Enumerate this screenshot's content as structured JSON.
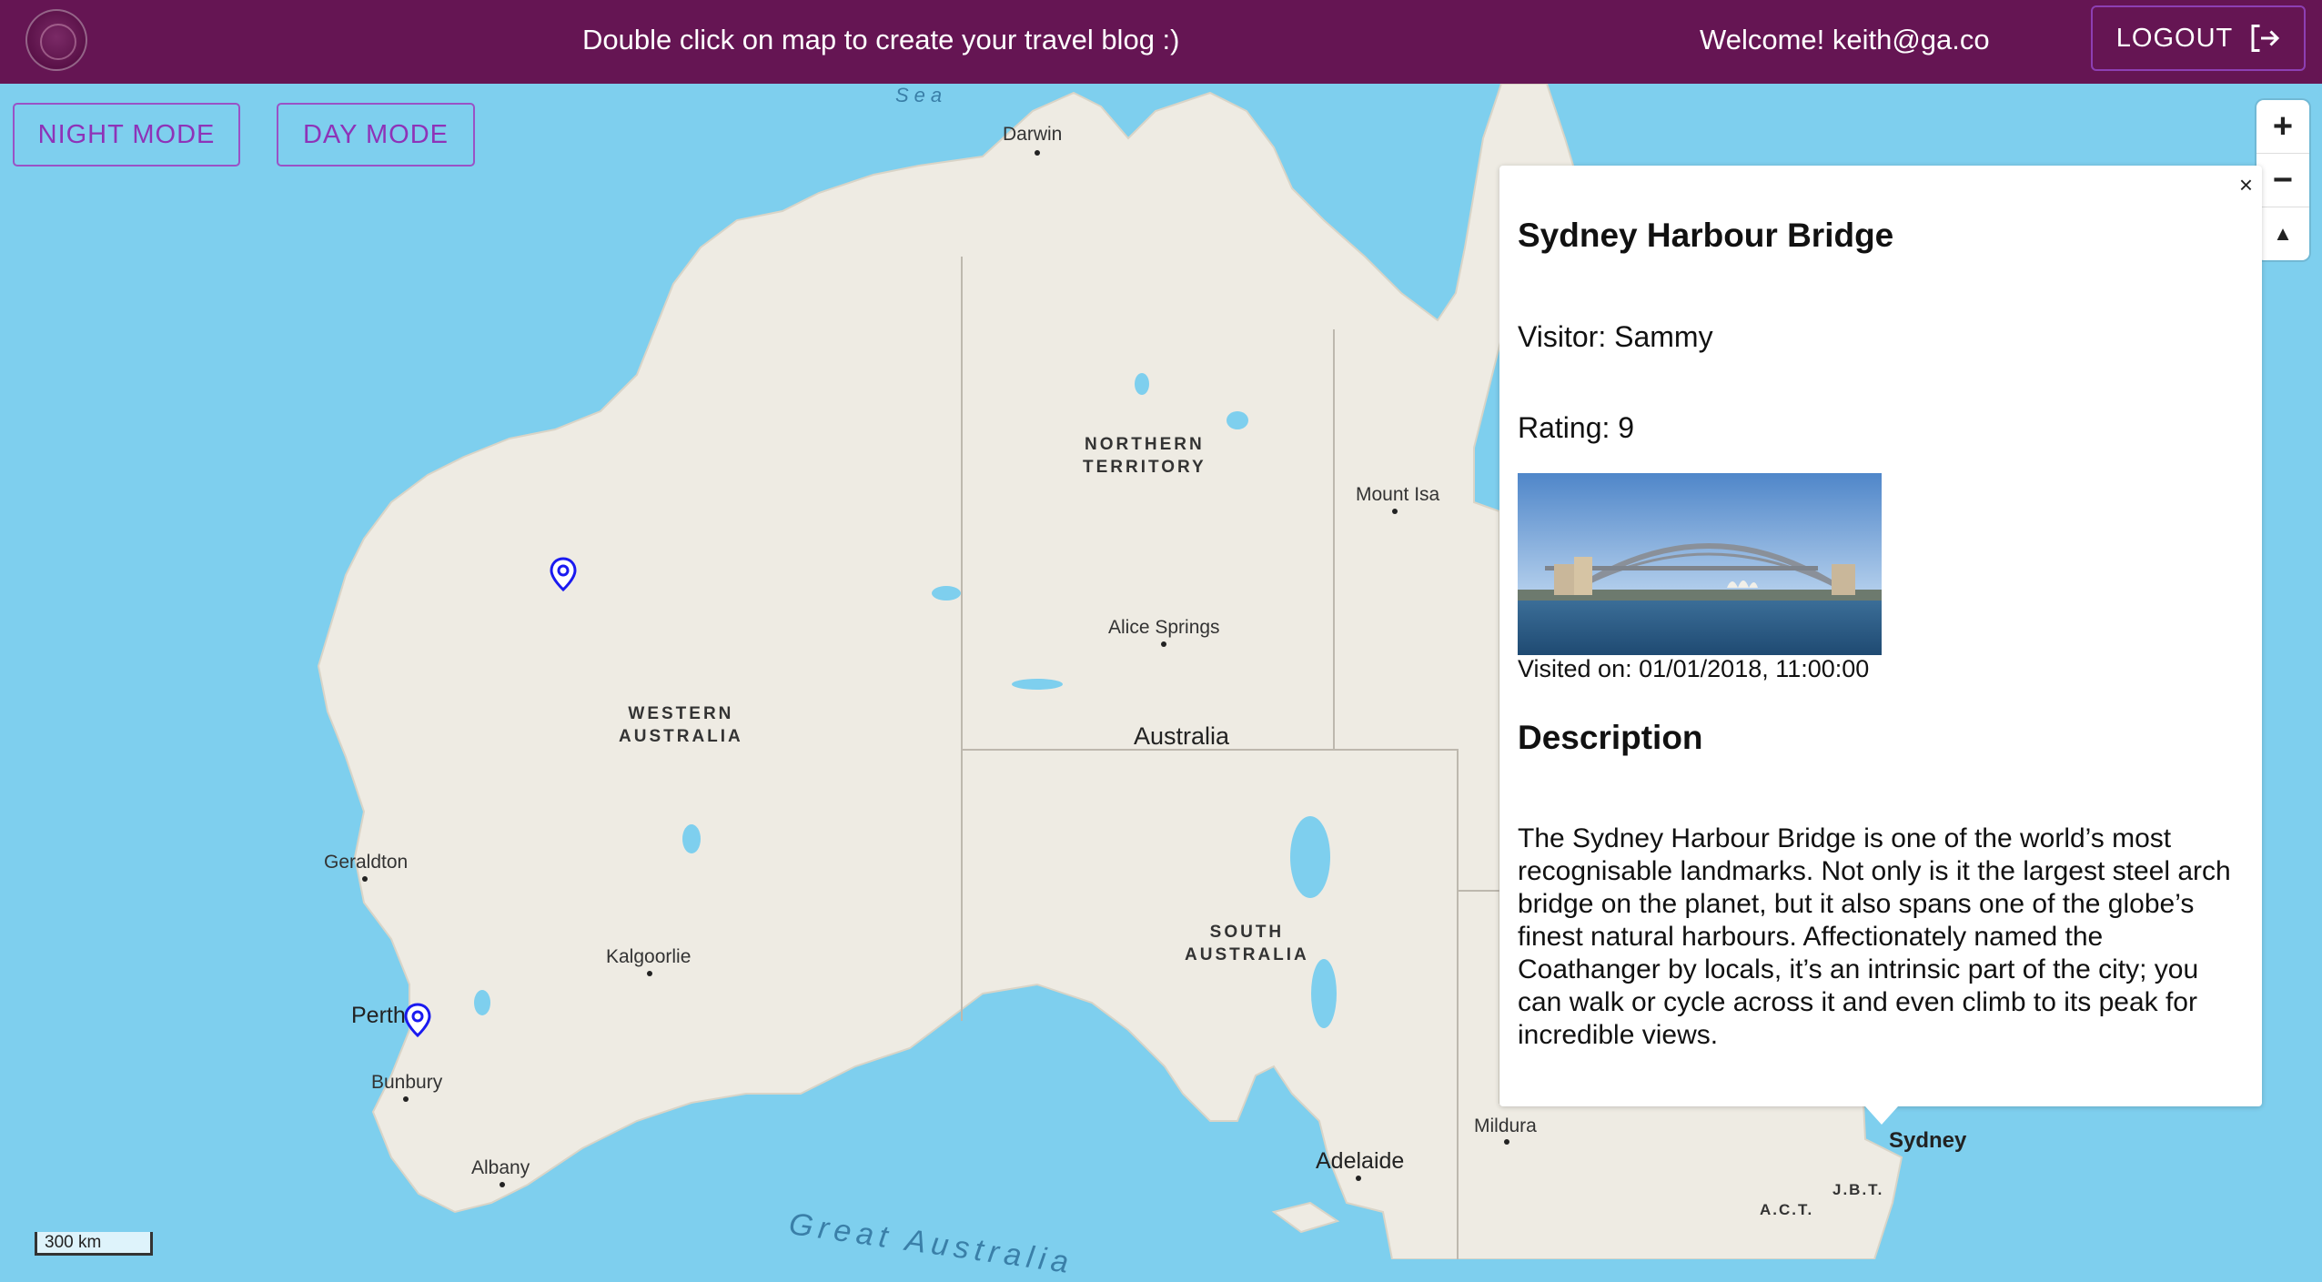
{
  "header": {
    "message": "Double click on map to create your travel blog :)",
    "welcome": "Welcome! keith@ga.co",
    "logout_label": "LOGOUT"
  },
  "controls": {
    "night_mode_label": "NIGHT MODE",
    "day_mode_label": "DAY MODE",
    "zoom_in": "+",
    "zoom_out": "−",
    "compass": "▲"
  },
  "map": {
    "regions": {
      "northern_territory": "NORTHERN\nTERRITORY",
      "western_australia": "WESTERN\nAUSTRALIA",
      "south_australia": "SOUTH\nAUSTRALIA"
    },
    "country": "Australia",
    "cities": {
      "darwin": "Darwin",
      "mount_isa": "Mount Isa",
      "alice_springs": "Alice Springs",
      "geraldton": "Geraldton",
      "kalgoorlie": "Kalgoorlie",
      "perth": "Perth",
      "bunbury": "Bunbury",
      "albany": "Albany",
      "adelaide": "Adelaide",
      "mildura": "Mildura",
      "sydney": "Sydney",
      "jbt": "J.B.T.",
      "act": "A.C.T."
    },
    "sea_top": "Sea",
    "sea_bottom": "Great Australia",
    "scale_label": "300 km",
    "colors": {
      "water": "#7ecfee",
      "land": "#eeebe3",
      "marker": "#1a1af0"
    }
  },
  "popup": {
    "close_label": "×",
    "title": "Sydney Harbour Bridge",
    "visitor": "Visitor: Sammy",
    "rating": "Rating: 9",
    "visited": "Visited on: 01/01/2018, 11:00:00",
    "description_heading": "Description",
    "description": "The Sydney Harbour Bridge is one of the world’s most recognisable landmarks. Not only is it the largest steel arch bridge on the planet, but it also spans one of the globe’s finest natural harbours. Affectionately named the Coathanger by locals, it’s an intrinsic part of the city; you can walk or cycle across it and even climb to its peak for incredible views."
  }
}
